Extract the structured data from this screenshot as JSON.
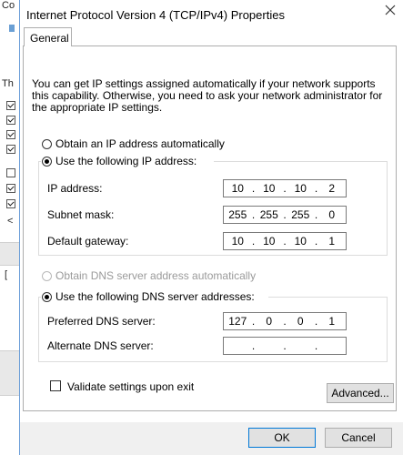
{
  "dialog": {
    "title": "Internet Protocol Version 4 (TCP/IPv4) Properties",
    "tab": "General",
    "intro": "You can get IP settings assigned automatically if your network supports this capability. Otherwise, you need to ask your network administrator for the appropriate IP settings.",
    "ip_auto_label": "Obtain an IP address automatically",
    "ip_manual_label": "Use the following IP address:",
    "ip_fields": [
      {
        "label": "IP address:",
        "octets": [
          "10",
          "10",
          "10",
          "2"
        ]
      },
      {
        "label": "Subnet mask:",
        "octets": [
          "255",
          "255",
          "255",
          "0"
        ]
      },
      {
        "label": "Default gateway:",
        "octets": [
          "10",
          "10",
          "10",
          "1"
        ]
      }
    ],
    "dns_auto_label": "Obtain DNS server address automatically",
    "dns_manual_label": "Use the following DNS server addresses:",
    "dns_fields": [
      {
        "label": "Preferred DNS server:",
        "octets": [
          "127",
          "0",
          "0",
          "1"
        ]
      },
      {
        "label": "Alternate DNS server:",
        "octets": [
          "",
          "",
          "",
          ""
        ]
      }
    ],
    "validate_label": "Validate settings upon exit",
    "advanced_label": "Advanced...",
    "ok_label": "OK",
    "cancel_label": "Cancel",
    "ip_mode": "manual",
    "dns_mode": "manual",
    "validate_checked": false
  },
  "background": {
    "fragments": [
      "Co",
      "Th",
      "<",
      "["
    ]
  },
  "colors": {
    "accent": "#0078d7",
    "dialog_border": "#6b9ed8"
  }
}
